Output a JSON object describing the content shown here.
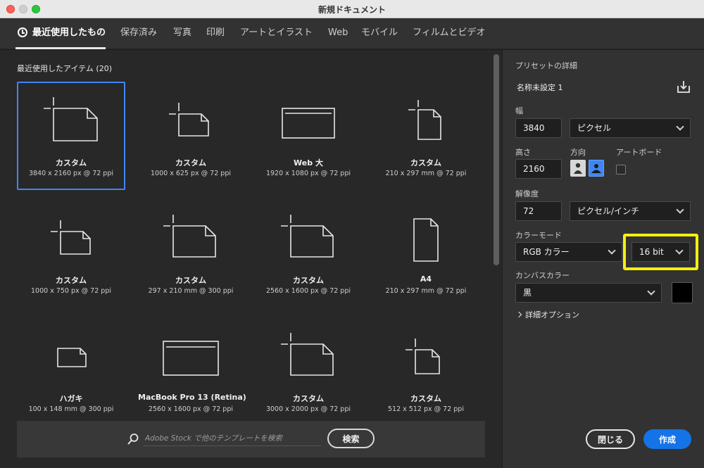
{
  "window": {
    "title": "新規ドキュメント"
  },
  "tabs": [
    {
      "label": "最近使用したもの"
    },
    {
      "label": "保存済み"
    },
    {
      "label": "写真"
    },
    {
      "label": "印刷"
    },
    {
      "label": "アートとイラスト"
    },
    {
      "label": "Web"
    },
    {
      "label": "モバイル"
    },
    {
      "label": "フィルムとビデオ"
    }
  ],
  "recent": {
    "title": "最近使用したアイテム",
    "count": "(20)",
    "items": [
      {
        "name": "カスタム",
        "detail": "3840 x 2160 px @ 72 ppi"
      },
      {
        "name": "カスタム",
        "detail": "1000 x 625 px @ 72 ppi"
      },
      {
        "name": "Web 大",
        "detail": "1920 x 1080 px @ 72 ppi"
      },
      {
        "name": "カスタム",
        "detail": "210 x 297 mm @ 72 ppi"
      },
      {
        "name": "カスタム",
        "detail": "1000 x 750 px @ 72 ppi"
      },
      {
        "name": "カスタム",
        "detail": "297 x 210 mm @ 300 ppi"
      },
      {
        "name": "カスタム",
        "detail": "2560 x 1600 px @ 72 ppi"
      },
      {
        "name": "A4",
        "detail": "210 x 297 mm @ 72 ppi"
      },
      {
        "name": "ハガキ",
        "detail": "100 x 148 mm @ 300 ppi"
      },
      {
        "name": "MacBook Pro 13 (Retina)",
        "detail": "2560 x 1600 px @ 72 ppi"
      },
      {
        "name": "カスタム",
        "detail": "3000 x 2000 px @ 72 ppi"
      },
      {
        "name": "カスタム",
        "detail": "512 x 512 px @ 72 ppi"
      }
    ]
  },
  "search": {
    "placeholder": "Adobe Stock で他のテンプレートを検索",
    "button": "検索"
  },
  "details": {
    "header": "プリセットの詳細",
    "preset_name": "名称未設定 1",
    "width_label": "幅",
    "width_value": "3840",
    "width_unit": "ピクセル",
    "height_label": "高さ",
    "height_value": "2160",
    "orientation_label": "方向",
    "artboard_label": "アートボード",
    "resolution_label": "解像度",
    "resolution_value": "72",
    "resolution_unit": "ピクセル/インチ",
    "color_mode_label": "カラーモード",
    "color_mode": "RGB カラー",
    "bit_depth": "16 bit",
    "canvas_color_label": "カンバスカラー",
    "canvas_color": "黒",
    "advanced_label": "詳細オプション",
    "close_button": "閉じる",
    "create_button": "作成"
  },
  "colors": {
    "accent": "#1473e6",
    "selection": "#3f86f5",
    "highlight": "#f5f00d"
  }
}
